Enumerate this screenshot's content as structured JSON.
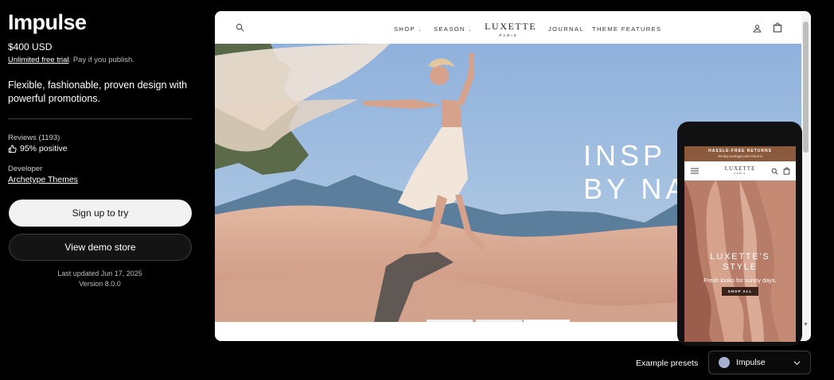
{
  "sidebar": {
    "title": "Impulse",
    "price": "$400 USD",
    "trial_link": "Unlimited free trial",
    "trial_note": ". Pay if you publish.",
    "tagline": "Flexible, fashionable, proven design with powerful promotions.",
    "reviews_label": "Reviews (1193)",
    "rating_text": "95% positive",
    "rating_icon": "thumbs-up-icon",
    "developer_label": "Developer",
    "developer_name": "Archetype Themes",
    "primary_button": "Sign up to try",
    "secondary_button": "View demo store",
    "last_updated": "Last updated Jun 17, 2025",
    "version": "Version 8.0.0"
  },
  "preview": {
    "nav": {
      "shop": "SHOP",
      "season": "SEASON",
      "journal": "JOURNAL",
      "theme_features": "THEME FEATURES"
    },
    "logo": {
      "name": "LUXETTE",
      "sub": "PARIS"
    },
    "hero": {
      "line1": "INSP",
      "line2": "BY NA"
    },
    "icons": [
      "search-icon",
      "account-icon",
      "cart-icon"
    ]
  },
  "phone": {
    "announcement": "HASSLE-FREE RETURNS",
    "announcement_sub": "30-day postage paid returns",
    "logo": {
      "name": "LUXETTE",
      "sub": "PARIS"
    },
    "hero_title": "LUXETTE'S",
    "hero_title_2": "STYLE",
    "hero_sub": "Fresh looks for sunny days.",
    "hero_button": "SHOP ALL"
  },
  "presets": {
    "label": "Example presets",
    "selected": "Impulse",
    "swatch_color": "#a7b0cf"
  },
  "colors": {
    "background": "#000000",
    "primary_button_bg": "#f2f2f2",
    "announcement_bg": "#8b5a3c"
  }
}
